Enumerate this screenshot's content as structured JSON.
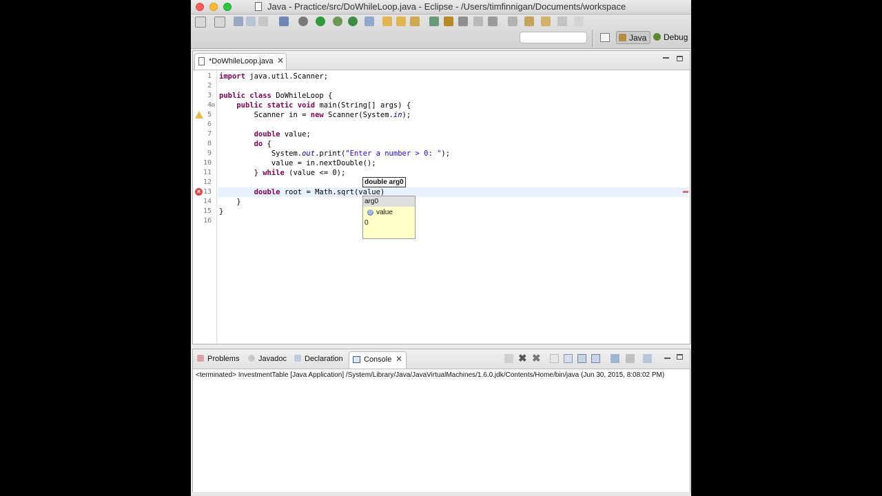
{
  "window": {
    "title": "Java - Practice/src/DoWhileLoop.java - Eclipse - /Users/timfinnigan/Documents/workspace"
  },
  "perspectives": {
    "java": "Java",
    "debug": "Debug"
  },
  "editor": {
    "tab_label": "*DoWhileLoop.java",
    "lines": [
      {
        "n": "1",
        "code": "import java.util.Scanner;"
      },
      {
        "n": "2",
        "code": ""
      },
      {
        "n": "3",
        "code": "public class DoWhileLoop {"
      },
      {
        "n": "4",
        "code": "    public static void main(String[] args) {"
      },
      {
        "n": "5",
        "code": "        Scanner in = new Scanner(System.in);"
      },
      {
        "n": "6",
        "code": ""
      },
      {
        "n": "7",
        "code": "        double value;"
      },
      {
        "n": "8",
        "code": "        do {"
      },
      {
        "n": "9",
        "code": "            System.out.print(\"Enter a number > 0: \");"
      },
      {
        "n": "10",
        "code": "            value = in.nextDouble();"
      },
      {
        "n": "11",
        "code": "        } while (value <= 0);"
      },
      {
        "n": "12",
        "code": ""
      },
      {
        "n": "13",
        "code": "        double root = Math.sqrt(value)"
      },
      {
        "n": "14",
        "code": "    }"
      },
      {
        "n": "15",
        "code": "}"
      },
      {
        "n": "16",
        "code": ""
      }
    ],
    "parameter_hint": "double arg0",
    "content_assist": {
      "items": [
        "arg0",
        "value",
        "0"
      ],
      "selected": "arg0"
    }
  },
  "views": {
    "problems": "Problems",
    "javadoc": "Javadoc",
    "declaration": "Declaration",
    "console": "Console"
  },
  "console": {
    "status": "<terminated> InvestmentTable [Java Application] /System/Library/Java/JavaVirtualMachines/1.6.0.jdk/Contents/Home/bin/java (Jun 30, 2015, 8:08:02 PM)"
  },
  "colors": {
    "keyword": "#7f0055",
    "string": "#2a00ff",
    "current_line": "#e8f2fe",
    "assist_bg": "#ffffc8"
  }
}
